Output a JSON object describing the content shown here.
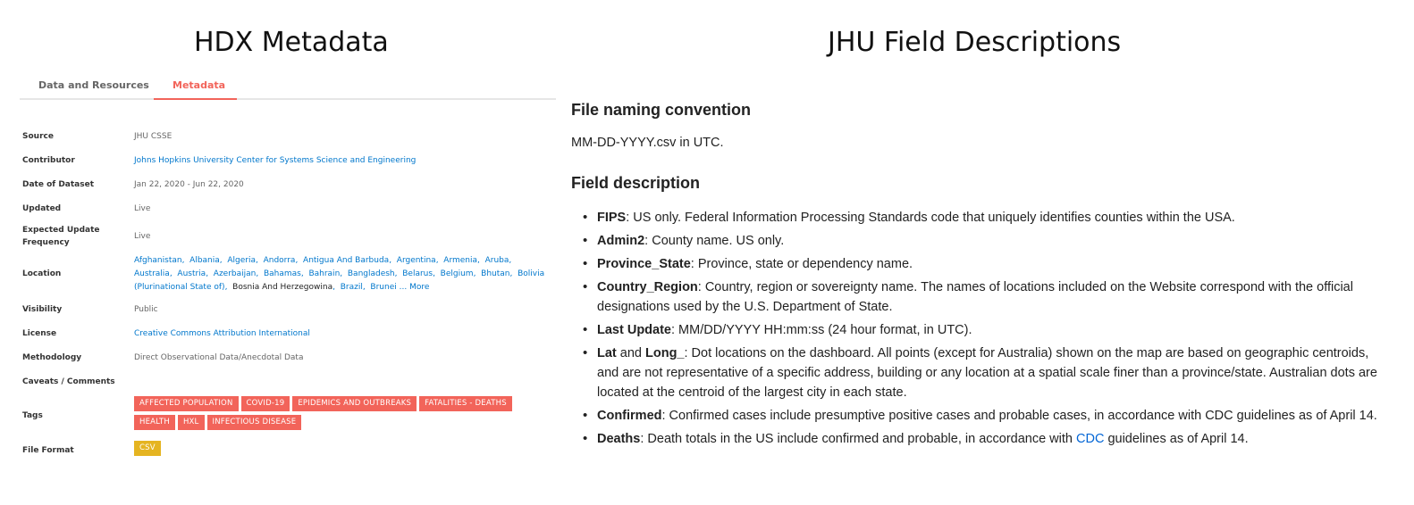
{
  "left_panel": {
    "title": "HDX Metadata",
    "tabs": [
      "Data and Resources",
      "Metadata"
    ],
    "rows": {
      "source": {
        "label": "Source",
        "value": "JHU CSSE"
      },
      "contributor": {
        "label": "Contributor",
        "value": "Johns Hopkins University Center for Systems Science and Engineering"
      },
      "date": {
        "label": "Date of Dataset",
        "value": "Jan 22, 2020 - Jun 22, 2020"
      },
      "updated": {
        "label": "Updated",
        "value": "Live"
      },
      "frequency": {
        "label": "Expected Update Frequency",
        "value": "Live"
      },
      "location": {
        "label": "Location",
        "values": [
          "Afghanistan",
          "Albania",
          "Algeria",
          "Andorra",
          "Antigua And Barbuda",
          "Argentina",
          "Armenia",
          "Aruba",
          "Australia",
          "Austria",
          "Azerbaijan",
          "Bahamas",
          "Bahrain",
          "Bangladesh",
          "Belarus",
          "Belgium",
          "Bhutan",
          "Bolivia (Plurinational State of)",
          "Bosnia And Herzegowina",
          "Brazil",
          "Brunei"
        ],
        "more": "... More"
      },
      "visibility": {
        "label": "Visibility",
        "value": "Public"
      },
      "license": {
        "label": "License",
        "value": "Creative Commons Attribution International"
      },
      "methodology": {
        "label": "Methodology",
        "value": "Direct Observational Data/Anecdotal Data"
      },
      "caveats": {
        "label": "Caveats / Comments",
        "value": ""
      },
      "tags": {
        "label": "Tags",
        "values": [
          "AFFECTED POPULATION",
          "COVID-19",
          "EPIDEMICS AND OUTBREAKS",
          "FATALITIES - DEATHS",
          "HEALTH",
          "HXL",
          "INFECTIOUS DISEASE"
        ]
      },
      "file_format": {
        "label": "File Format",
        "value": "CSV"
      }
    },
    "colors": {
      "accent": "#f2645a",
      "link": "#0077cc",
      "csv_badge": "#e5b421"
    }
  },
  "right_panel": {
    "title": "JHU Field Descriptions",
    "naming_heading": "File naming convention",
    "naming_text": "MM-DD-YYYY.csv in UTC.",
    "field_heading": "Field description",
    "fields": [
      {
        "name": "FIPS",
        "desc": ": US only. Federal Information Processing Standards code that uniquely identifies counties within the USA."
      },
      {
        "name": "Admin2",
        "desc": ": County name. US only."
      },
      {
        "name": "Province_State",
        "desc": ": Province, state or dependency name."
      },
      {
        "name": "Country_Region",
        "desc": ": Country, region or sovereignty name. The names of locations included on the Website correspond with the official designations used by the U.S. Department of State."
      },
      {
        "name": "Last Update",
        "desc": ": MM/DD/YYYY HH:mm:ss (24 hour format, in UTC)."
      },
      {
        "name": "Lat",
        "connector": " and ",
        "name2": "Long_",
        "desc": ": Dot locations on the dashboard. All points (except for Australia) shown on the map are based on geographic centroids, and are not representative of a specific address, building or any location at a spatial scale finer than a province/state. Australian dots are located at the centroid of the largest city in each state."
      },
      {
        "name": "Confirmed",
        "desc": ": Confirmed cases include presumptive positive cases and probable cases, in accordance with CDC guidelines as of April 14."
      },
      {
        "name": "Deaths",
        "desc": ": Death totals in the US include confirmed and probable, in accordance with ",
        "link": "CDC",
        "desc_after": " guidelines as of April 14."
      }
    ]
  }
}
